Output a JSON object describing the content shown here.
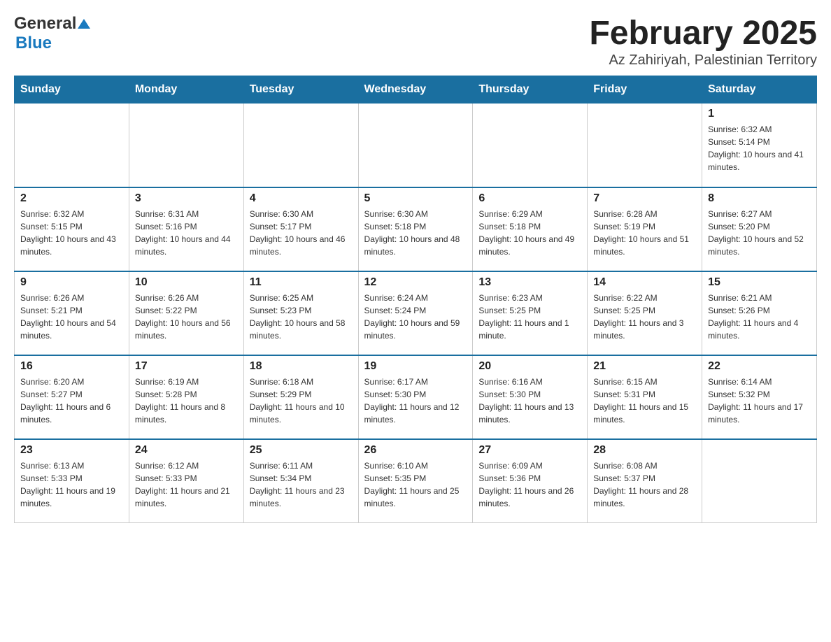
{
  "logo": {
    "general": "General",
    "blue": "Blue",
    "triangle": "▲"
  },
  "title": "February 2025",
  "location": "Az Zahiriyah, Palestinian Territory",
  "days_header": [
    "Sunday",
    "Monday",
    "Tuesday",
    "Wednesday",
    "Thursday",
    "Friday",
    "Saturday"
  ],
  "weeks": [
    [
      {
        "day": "",
        "info": ""
      },
      {
        "day": "",
        "info": ""
      },
      {
        "day": "",
        "info": ""
      },
      {
        "day": "",
        "info": ""
      },
      {
        "day": "",
        "info": ""
      },
      {
        "day": "",
        "info": ""
      },
      {
        "day": "1",
        "info": "Sunrise: 6:32 AM\nSunset: 5:14 PM\nDaylight: 10 hours and 41 minutes."
      }
    ],
    [
      {
        "day": "2",
        "info": "Sunrise: 6:32 AM\nSunset: 5:15 PM\nDaylight: 10 hours and 43 minutes."
      },
      {
        "day": "3",
        "info": "Sunrise: 6:31 AM\nSunset: 5:16 PM\nDaylight: 10 hours and 44 minutes."
      },
      {
        "day": "4",
        "info": "Sunrise: 6:30 AM\nSunset: 5:17 PM\nDaylight: 10 hours and 46 minutes."
      },
      {
        "day": "5",
        "info": "Sunrise: 6:30 AM\nSunset: 5:18 PM\nDaylight: 10 hours and 48 minutes."
      },
      {
        "day": "6",
        "info": "Sunrise: 6:29 AM\nSunset: 5:18 PM\nDaylight: 10 hours and 49 minutes."
      },
      {
        "day": "7",
        "info": "Sunrise: 6:28 AM\nSunset: 5:19 PM\nDaylight: 10 hours and 51 minutes."
      },
      {
        "day": "8",
        "info": "Sunrise: 6:27 AM\nSunset: 5:20 PM\nDaylight: 10 hours and 52 minutes."
      }
    ],
    [
      {
        "day": "9",
        "info": "Sunrise: 6:26 AM\nSunset: 5:21 PM\nDaylight: 10 hours and 54 minutes."
      },
      {
        "day": "10",
        "info": "Sunrise: 6:26 AM\nSunset: 5:22 PM\nDaylight: 10 hours and 56 minutes."
      },
      {
        "day": "11",
        "info": "Sunrise: 6:25 AM\nSunset: 5:23 PM\nDaylight: 10 hours and 58 minutes."
      },
      {
        "day": "12",
        "info": "Sunrise: 6:24 AM\nSunset: 5:24 PM\nDaylight: 10 hours and 59 minutes."
      },
      {
        "day": "13",
        "info": "Sunrise: 6:23 AM\nSunset: 5:25 PM\nDaylight: 11 hours and 1 minute."
      },
      {
        "day": "14",
        "info": "Sunrise: 6:22 AM\nSunset: 5:25 PM\nDaylight: 11 hours and 3 minutes."
      },
      {
        "day": "15",
        "info": "Sunrise: 6:21 AM\nSunset: 5:26 PM\nDaylight: 11 hours and 4 minutes."
      }
    ],
    [
      {
        "day": "16",
        "info": "Sunrise: 6:20 AM\nSunset: 5:27 PM\nDaylight: 11 hours and 6 minutes."
      },
      {
        "day": "17",
        "info": "Sunrise: 6:19 AM\nSunset: 5:28 PM\nDaylight: 11 hours and 8 minutes."
      },
      {
        "day": "18",
        "info": "Sunrise: 6:18 AM\nSunset: 5:29 PM\nDaylight: 11 hours and 10 minutes."
      },
      {
        "day": "19",
        "info": "Sunrise: 6:17 AM\nSunset: 5:30 PM\nDaylight: 11 hours and 12 minutes."
      },
      {
        "day": "20",
        "info": "Sunrise: 6:16 AM\nSunset: 5:30 PM\nDaylight: 11 hours and 13 minutes."
      },
      {
        "day": "21",
        "info": "Sunrise: 6:15 AM\nSunset: 5:31 PM\nDaylight: 11 hours and 15 minutes."
      },
      {
        "day": "22",
        "info": "Sunrise: 6:14 AM\nSunset: 5:32 PM\nDaylight: 11 hours and 17 minutes."
      }
    ],
    [
      {
        "day": "23",
        "info": "Sunrise: 6:13 AM\nSunset: 5:33 PM\nDaylight: 11 hours and 19 minutes."
      },
      {
        "day": "24",
        "info": "Sunrise: 6:12 AM\nSunset: 5:33 PM\nDaylight: 11 hours and 21 minutes."
      },
      {
        "day": "25",
        "info": "Sunrise: 6:11 AM\nSunset: 5:34 PM\nDaylight: 11 hours and 23 minutes."
      },
      {
        "day": "26",
        "info": "Sunrise: 6:10 AM\nSunset: 5:35 PM\nDaylight: 11 hours and 25 minutes."
      },
      {
        "day": "27",
        "info": "Sunrise: 6:09 AM\nSunset: 5:36 PM\nDaylight: 11 hours and 26 minutes."
      },
      {
        "day": "28",
        "info": "Sunrise: 6:08 AM\nSunset: 5:37 PM\nDaylight: 11 hours and 28 minutes."
      },
      {
        "day": "",
        "info": ""
      }
    ]
  ]
}
